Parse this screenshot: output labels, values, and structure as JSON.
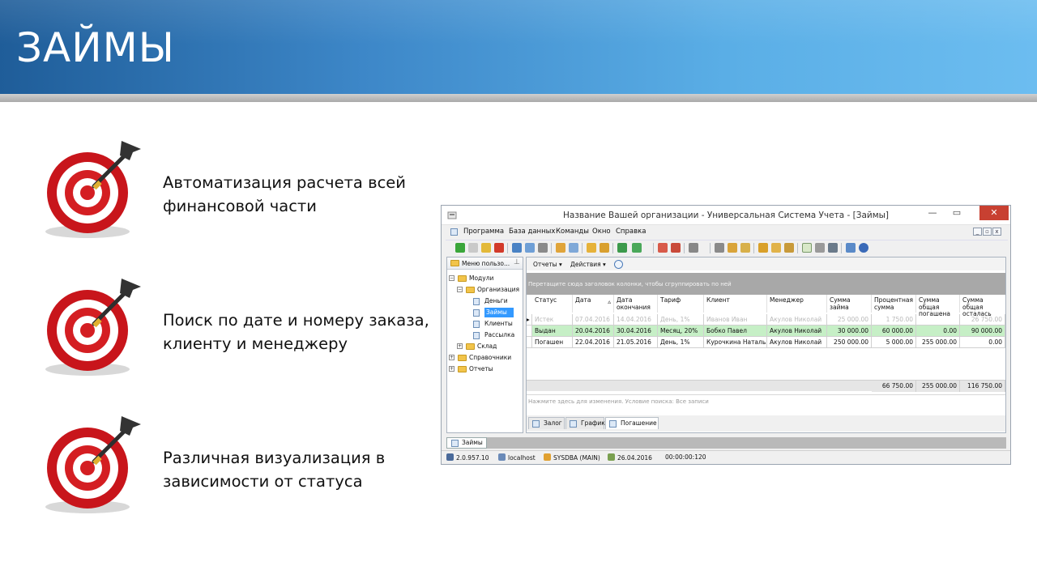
{
  "slide": {
    "title": "ЗАЙМЫ",
    "bullets": [
      {
        "icon": "target-dart-icon",
        "lines": [
          "Автоматизация расчета всей",
          "финансовой части"
        ]
      },
      {
        "icon": "target-dart-icon",
        "lines": [
          "Поиск по дате и номеру заказа,",
          "клиенту и менеджеру"
        ]
      },
      {
        "icon": "target-dart-icon",
        "lines": [
          "Различная визуализация в",
          "зависимости от статуса"
        ]
      }
    ]
  },
  "window": {
    "title": "Название Вашей организации - Универсальная Система Учета - [Займы]",
    "menu": [
      "Программа",
      "База данных",
      "Команды",
      "Окно",
      "Справка"
    ],
    "nav": {
      "header": "Меню пользо...",
      "tree": {
        "modules": "Модули",
        "organization": "Организация",
        "money": "Деньги",
        "loans": "Займы",
        "clients": "Клиенты",
        "mailing": "Рассылка",
        "warehouse": "Склад",
        "references": "Справочники",
        "reports": "Отчеты"
      }
    },
    "grid_toolbar": {
      "reports": "Отчеты ▾",
      "actions": "Действия ▾"
    },
    "group_hint": "Перетащите сюда заголовок колонки, чтобы сгруппировать по ней",
    "columns": [
      {
        "label": "Статус"
      },
      {
        "label": "Дата",
        "sort": "▵"
      },
      {
        "label": "Дата окончания"
      },
      {
        "label": "Тариф"
      },
      {
        "label": "Клиент"
      },
      {
        "label": "Менеджер"
      },
      {
        "label": "Сумма займа"
      },
      {
        "label": "Процентная сумма"
      },
      {
        "label": "Сумма общая погашена"
      },
      {
        "label": "Сумма общая осталась"
      }
    ],
    "rows": [
      {
        "style": "faded",
        "cells": [
          "Истек",
          "07.04.2016",
          "14.04.2016",
          "День, 1%",
          "Иванов Иван",
          "Акулов Николай",
          "25 000.00",
          "1 750.00",
          "",
          "26 750.00"
        ]
      },
      {
        "style": "green",
        "cells": [
          "Выдан",
          "20.04.2016",
          "30.04.2016",
          "Месяц, 20%",
          "Бобко Павел",
          "Акулов Николай",
          "30 000.00",
          "60 000.00",
          "0.00",
          "90 000.00"
        ]
      },
      {
        "style": "normal",
        "cells": [
          "Погашен",
          "22.04.2016",
          "21.05.2016",
          "День, 1%",
          "Курочкина Наталья",
          "Акулов Николай",
          "250 000.00",
          "5 000.00",
          "255 000.00",
          "0.00"
        ]
      }
    ],
    "totals": {
      "interest": "66 750.00",
      "repaid": "255 000.00",
      "remaining": "116 750.00"
    },
    "filter_hint": "Нажмите здесь для изменения. Условие поиска: Все записи",
    "detail_tabs": [
      "Залог",
      "График",
      "Погашение"
    ],
    "active_detail_tab": "Погашение",
    "bottom_tab": "Займы",
    "status": {
      "version": "2.0.957.10",
      "host": "localhost",
      "user": "SYSDBA (MAIN)",
      "date": "26.04.2016",
      "timer": "00:00:00:120"
    }
  }
}
